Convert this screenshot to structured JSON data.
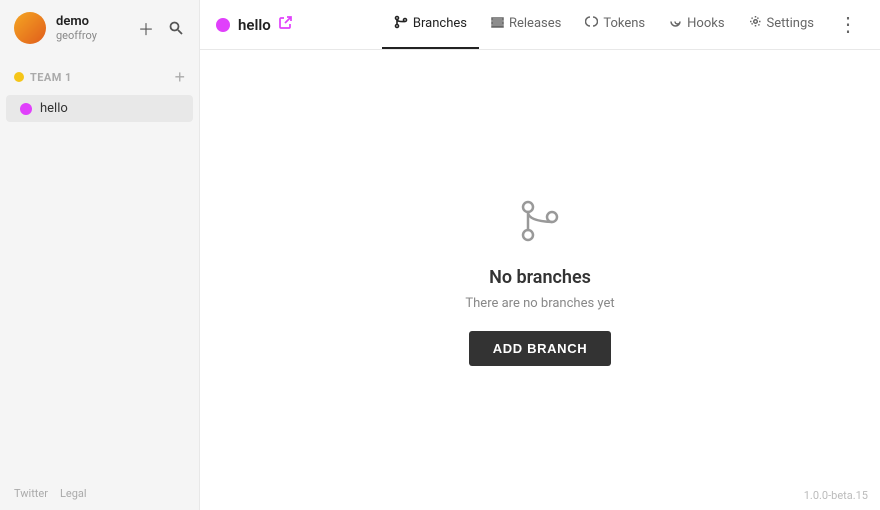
{
  "sidebar": {
    "user": {
      "name": "demo",
      "username": "geoffroy"
    },
    "team": {
      "label": "Team 1",
      "dot_color": "#f5c518"
    },
    "projects": [
      {
        "name": "hello",
        "color": "#e040fb",
        "active": true
      }
    ],
    "footer": {
      "links": [
        "Twitter",
        "Legal"
      ]
    }
  },
  "topnav": {
    "project_name": "hello",
    "tabs": [
      {
        "id": "branches",
        "label": "Branches",
        "active": true
      },
      {
        "id": "releases",
        "label": "Releases",
        "active": false
      },
      {
        "id": "tokens",
        "label": "Tokens",
        "active": false
      },
      {
        "id": "hooks",
        "label": "Hooks",
        "active": false
      },
      {
        "id": "settings",
        "label": "Settings",
        "active": false
      }
    ]
  },
  "empty_state": {
    "title": "No branches",
    "subtitle": "There are no branches yet",
    "button_label": "ADD BRANCH"
  },
  "version": "1.0.0-beta.15"
}
